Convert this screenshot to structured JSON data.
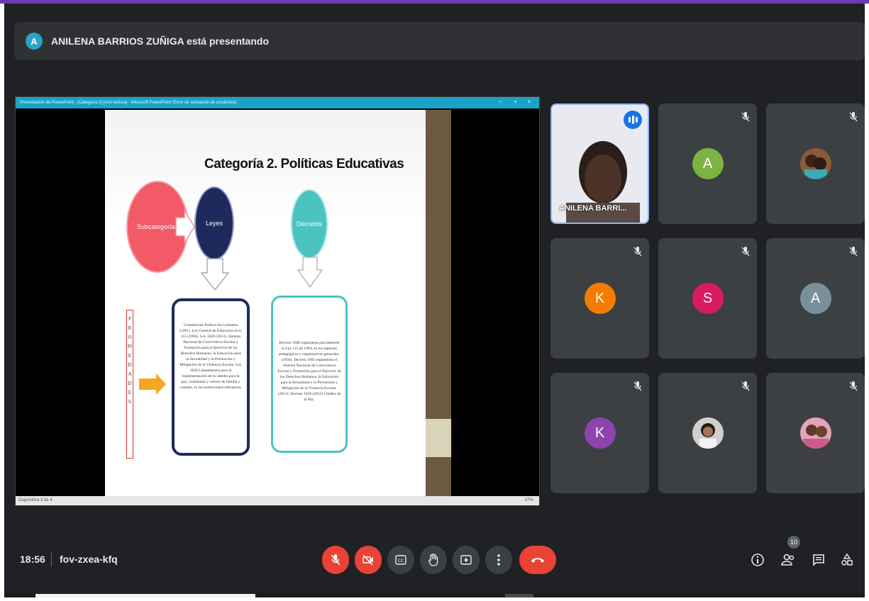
{
  "presenter_banner": {
    "avatar_letter": "A",
    "text": "ANILENA BARRIOS ZUÑIGA está presentando"
  },
  "shared_window": {
    "title": "Presentación de PowerPoint - [Categoría 2] [solo lectura] - Microsoft PowerPoint (Error de activación de productos)",
    "status_left": "Diapositiva 3 de 4",
    "status_right": "57%"
  },
  "slide": {
    "title": "Categoría 2. Políticas Educativas",
    "circle_left": "Subcategorías",
    "circle_leyes": "Leyes",
    "circle_decretos": "Decretos",
    "vertical_word": "PROPIEDADES",
    "leyes_text": "Constitución Política de Colombia (1991). Ley General de Educación (Ley 115 (1994). Ley 1620 (2013). Sistema Nacional de Convivencia Escolar y Formación para el Ejercicio de los Derechos Humanos, la Educación para la Sexualidad y la Prevención y Mitigación de la Violencia Escolar. Ley 1620 Lineamientos para la implementación de la cátedra para la paz, ciudadanía y valores de familia y cuidado, en las instituciones educativas.",
    "decretos_text": "Decreto 1860 reglamenta parcialmente la Ley 115 de 1994, en los aspectos pedagógicos y organizativos generales. (1994). Decreto 1965 reglamenta el Sistema Nacional de Convivencia Escolar y Formación para el Ejercicio de los Derechos Humanos, la Educación para la Sexualidad y la Prevención y Mitigación de la Violencia Escolar. (2013). Decreto 1038 (2015) Cátedra de la Paz."
  },
  "participants": [
    {
      "kind": "video",
      "name": "ANILENA BARRI...",
      "speaking": true
    },
    {
      "kind": "letter",
      "letter": "A",
      "color": "#7cb342"
    },
    {
      "kind": "photo"
    },
    {
      "kind": "letter",
      "letter": "K",
      "color": "#f57c00"
    },
    {
      "kind": "letter",
      "letter": "S",
      "color": "#d81b60"
    },
    {
      "kind": "letter",
      "letter": "A",
      "color": "#78909c"
    },
    {
      "kind": "letter",
      "letter": "K",
      "color": "#8e44ad"
    },
    {
      "kind": "photo"
    },
    {
      "kind": "photo"
    }
  ],
  "tiles": {
    "t1_letter": "A",
    "t3_letter": "K",
    "t4_letter": "S",
    "t5_letter": "A",
    "t6_letter": "K"
  },
  "bottom_bar": {
    "time": "18:56",
    "meeting_code": "fov-zxea-kfq",
    "participant_count": "10",
    "controls": [
      "mic-off-icon",
      "camera-off-icon",
      "captions-icon",
      "raise-hand-icon",
      "present-icon",
      "more-options-icon",
      "end-call-icon"
    ],
    "right_controls": [
      "info-icon",
      "people-icon",
      "chat-icon",
      "activities-icon"
    ]
  },
  "colors": {
    "background": "#202124",
    "tile": "#3c4043",
    "red": "#ea4335",
    "accent_blue": "#8ab4f8"
  }
}
